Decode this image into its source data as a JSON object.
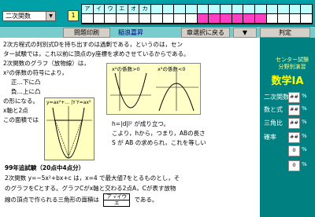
{
  "top": {
    "subject_select": "二次関数",
    "question_number": "1",
    "answer_letters": [
      "ア",
      "イ",
      "ウ",
      "エ",
      "オ",
      "カ",
      "",
      "",
      "",
      "",
      "",
      "",
      "",
      "",
      "",
      "",
      "",
      "",
      "",
      ""
    ]
  },
  "toolbar": {
    "print_label": "問題印刷",
    "caption": "稲浪嘉昇",
    "back_label": "章選択に戻る",
    "next_icon": "▼",
    "judge_label": "判定"
  },
  "content": {
    "lines_intro": [
      "2次方程式の判別式Dを持ち出すのは過剰である，というのは，セン",
      "ター試験では，これ以前に頂点のy座標を求めさせているからである。",
      "2次関数のグラフ（放物線）は，",
      "x²の係数の符号により，",
      "正…下に凸",
      "負…上に凸",
      "の形になる。",
      "x軸と2点",
      "この面積では"
    ],
    "graph_left_title": "x²の係数>0",
    "graph_right_title": "x²の係数<0",
    "big_graph_label": "y=ax²+… |Y",
    "big_graph_label2": "Y=ax²",
    "mid_text": "",
    "right_lines": [
      "h=|d|l² が成り立つ。",
      "こより，hから，つまり，ABの長さ",
      "S が AB の求められ，これを等しい"
    ],
    "problem_title": "99年追試験（20点中4点分）",
    "problem_lines": [
      "2次関数 y=−5x²+bx+c は，x=4 で最大値7をとるものとし，そ",
      "のグラフをCとする。グラフCがx軸と交わる2点A，Cが表す放物",
      "線の頂点で作られる三角形の面積は",
      "である。"
    ],
    "fraction_numerator": "ア √イウ",
    "fraction_denominator": "エ"
  },
  "right_panel": {
    "title_line1": "センター試験",
    "title_line2": "分野別演習",
    "subject": "数学ⅠA",
    "rows": [
      {
        "label": "二次関数",
        "value": "##",
        "pct": "%"
      },
      {
        "label": "数と式",
        "value": "##",
        "pct": "%"
      },
      {
        "label": "三角比",
        "value": "##",
        "pct": "%"
      },
      {
        "label": "確率",
        "value": "##",
        "pct": "%"
      },
      {
        "label": "",
        "value": "0",
        "pct": "%"
      },
      {
        "label": "",
        "value": "0",
        "pct": "%"
      }
    ]
  }
}
